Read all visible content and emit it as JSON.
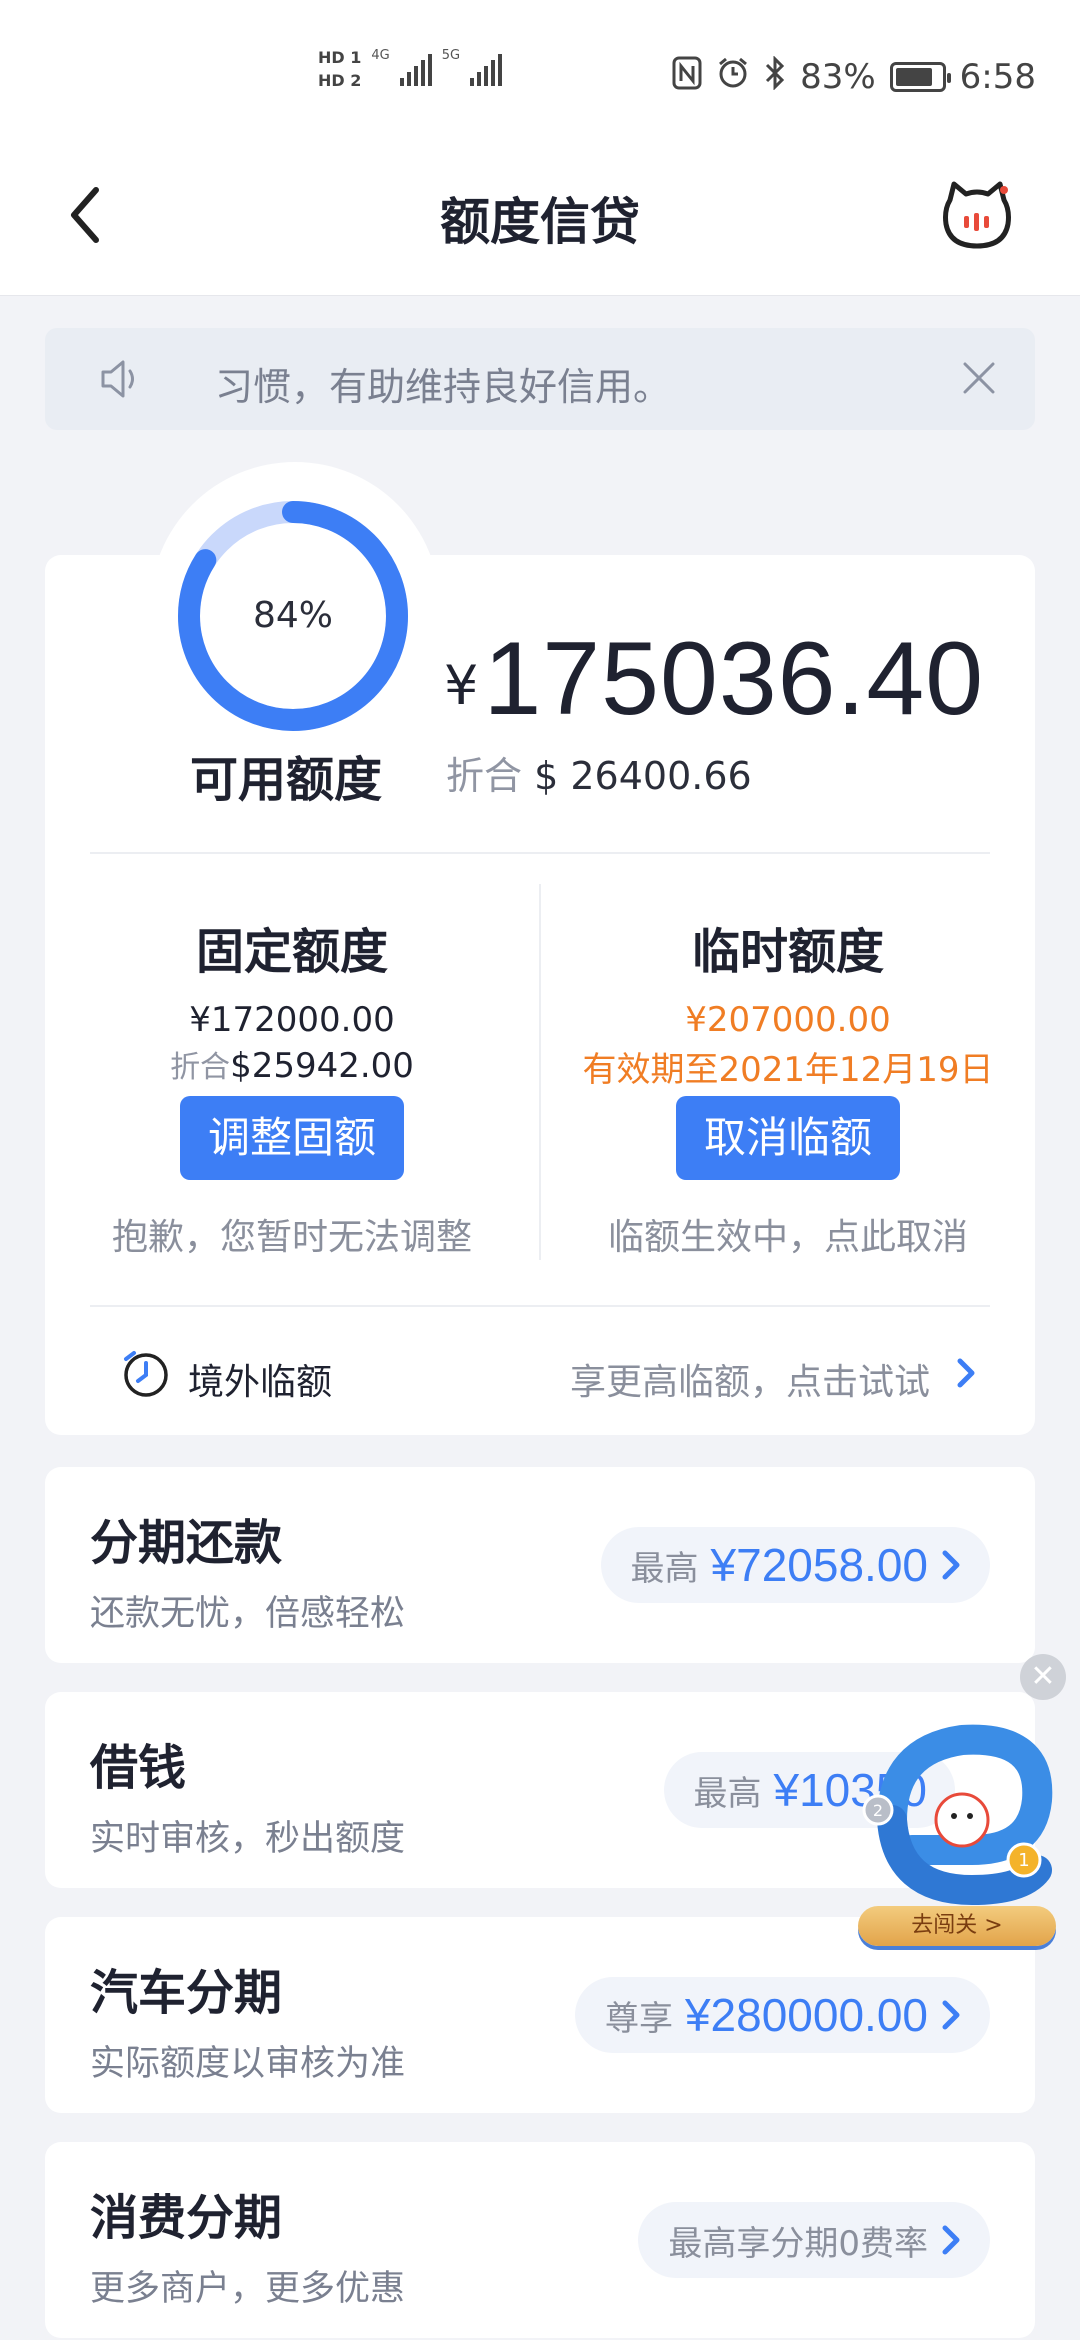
{
  "status_bar": {
    "hd1": "HD 1",
    "hd2": "HD 2",
    "net1": "4G",
    "net2": "5G",
    "battery": "83%",
    "battery_level": 0.83,
    "time": "6:58"
  },
  "nav": {
    "title": "额度信贷"
  },
  "notice": {
    "text": "习惯，有助维持良好信用。"
  },
  "credit": {
    "usage_percent": "84%",
    "usage_fraction": 0.84,
    "available_label": "可用额度",
    "currency_symbol": "¥",
    "available_amount": "175036.40",
    "converted_prefix": "折合",
    "converted_amount": "$ 26400.66",
    "fixed": {
      "title": "固定额度",
      "amount": "¥172000.00",
      "converted_prefix": "折合",
      "converted_amount": "$25942.00",
      "button": "调整固额",
      "hint": "抱歉，您暂时无法调整"
    },
    "temporary": {
      "title": "临时额度",
      "amount": "¥207000.00",
      "validity": "有效期至2021年12月19日",
      "button": "取消临额",
      "hint": "临额生效中，点此取消"
    },
    "overseas": {
      "label": "境外临额",
      "promo": "享更高临额，点击试试"
    }
  },
  "products": [
    {
      "title": "分期还款",
      "subtitle": "还款无忧，倍感轻松",
      "prefix": "最高",
      "value": "¥72058.00"
    },
    {
      "title": "借钱",
      "subtitle": "实时审核，秒出额度",
      "prefix": "最高",
      "value": "¥10350"
    },
    {
      "title": "汽车分期",
      "subtitle": "实际额度以审核为准",
      "prefix": "尊享",
      "value": "¥280000.00"
    },
    {
      "title": "消费分期",
      "subtitle": "更多商户，更多优惠",
      "prefix": "最高享分期0费率",
      "value": ""
    }
  ],
  "floating": {
    "button": "去闯关 >"
  },
  "colors": {
    "accent": "#3d7ef5",
    "orange": "#f07d24",
    "ring_track": "#c9d8fb"
  }
}
